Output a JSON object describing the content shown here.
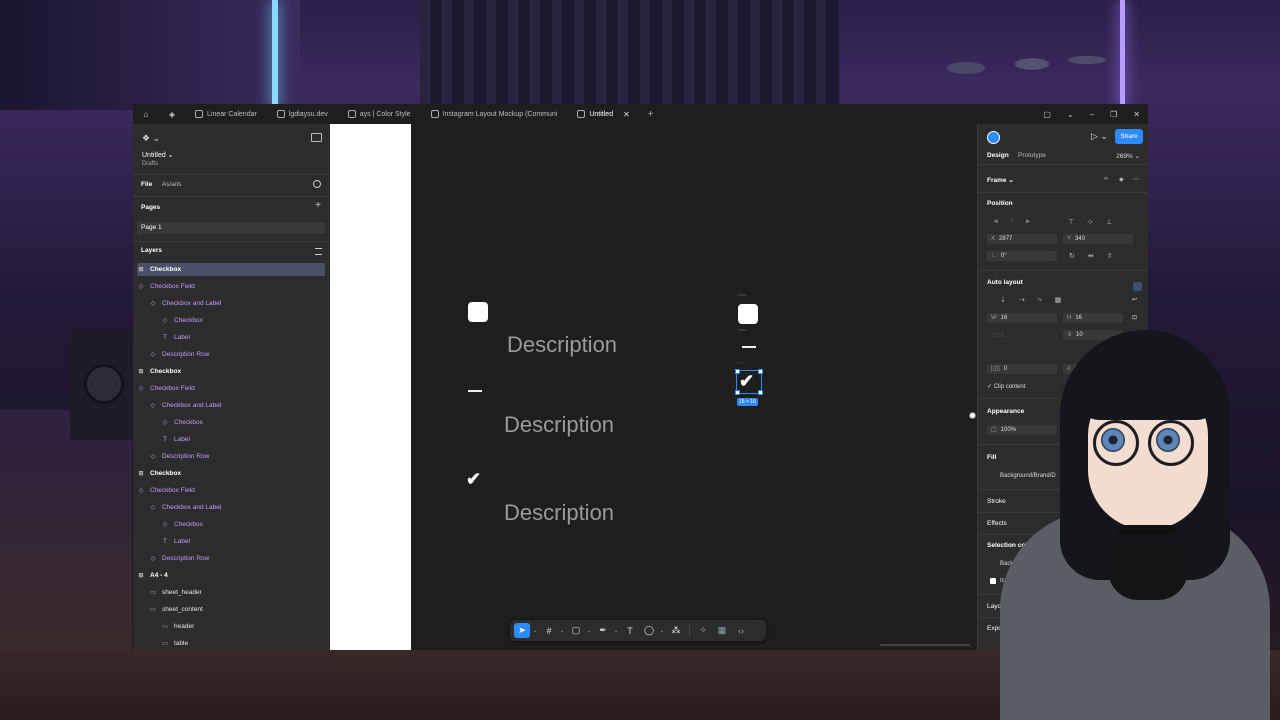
{
  "tabs": [
    {
      "label": "Linear Calendar",
      "active": false
    },
    {
      "label": "lgdiaysu.dev",
      "active": false
    },
    {
      "label": "ays | Color Style",
      "active": false
    },
    {
      "label": "Instagram Layout Mockup (Communi",
      "active": false
    },
    {
      "label": "Untitled",
      "active": true
    }
  ],
  "left_panel": {
    "file_name": "Untitled",
    "location": "Drafts",
    "tab_file": "File",
    "tab_assets": "Assets",
    "pages_title": "Pages",
    "page_1": "Page 1",
    "layers_title": "Layers",
    "layers": [
      {
        "label": "Checkbox",
        "kind": "comp",
        "selected": true
      },
      {
        "label": "Checkbox Field",
        "kind": "purple"
      },
      {
        "label": "Checkbox and Label",
        "kind": "purple"
      },
      {
        "label": "Checkbox",
        "kind": "purple"
      },
      {
        "label": "Label",
        "kind": "purple"
      },
      {
        "label": "Description Row",
        "kind": "purple"
      },
      {
        "label": "Checkbox",
        "kind": "comp"
      },
      {
        "label": "Checkbox Field",
        "kind": "purple"
      },
      {
        "label": "Checkbox and Label",
        "kind": "purple"
      },
      {
        "label": "Checkbox",
        "kind": "purple"
      },
      {
        "label": "Label",
        "kind": "purple"
      },
      {
        "label": "Description Row",
        "kind": "purple"
      },
      {
        "label": "Checkbox",
        "kind": "comp"
      },
      {
        "label": "Checkbox Field",
        "kind": "purple"
      },
      {
        "label": "Checkbox and Label",
        "kind": "purple"
      },
      {
        "label": "Checkbox",
        "kind": "purple"
      },
      {
        "label": "Label",
        "kind": "purple"
      },
      {
        "label": "Description Row",
        "kind": "purple"
      },
      {
        "label": "A4 - 4",
        "kind": "comp"
      },
      {
        "label": "sheet_header",
        "kind": "plain"
      },
      {
        "label": "sheet_content",
        "kind": "plain"
      },
      {
        "label": "header",
        "kind": "plain"
      },
      {
        "label": "table",
        "kind": "plain"
      }
    ]
  },
  "canvas": {
    "descriptions": [
      "Description",
      "Description",
      "Description"
    ],
    "size_badge": "16 × 16"
  },
  "right_panel": {
    "share": "Share",
    "tab_design": "Design",
    "tab_prototype": "Prototype",
    "zoom": "269%",
    "frame": "Frame",
    "position": "Position",
    "x_label": "X",
    "x_value": "2877",
    "y_label": "Y",
    "y_value": "340",
    "rotation": "0°",
    "auto_layout": "Auto layout",
    "w_label": "W",
    "w_value": "16",
    "h_label": "H",
    "h_value": "16",
    "gap_value": "10",
    "pad_left": "0",
    "pad_right": "0",
    "clip_content": "Clip content",
    "appearance": "Appearance",
    "opacity": "100%",
    "fill": "Fill",
    "fill_style": "Background/Brand/D",
    "stroke": "Stroke",
    "effects": "Effects",
    "selection_colors": "Selection col",
    "sel_color_1": "Back",
    "sel_color_2": "Icor Bra",
    "layout_guide": "Layout guide",
    "export": "Export"
  },
  "colors": {
    "accent": "#2d8bff",
    "component_purple": "#c49cff",
    "canvas_bg": "#1e1e1e",
    "panel_bg": "#2c2c2c"
  }
}
